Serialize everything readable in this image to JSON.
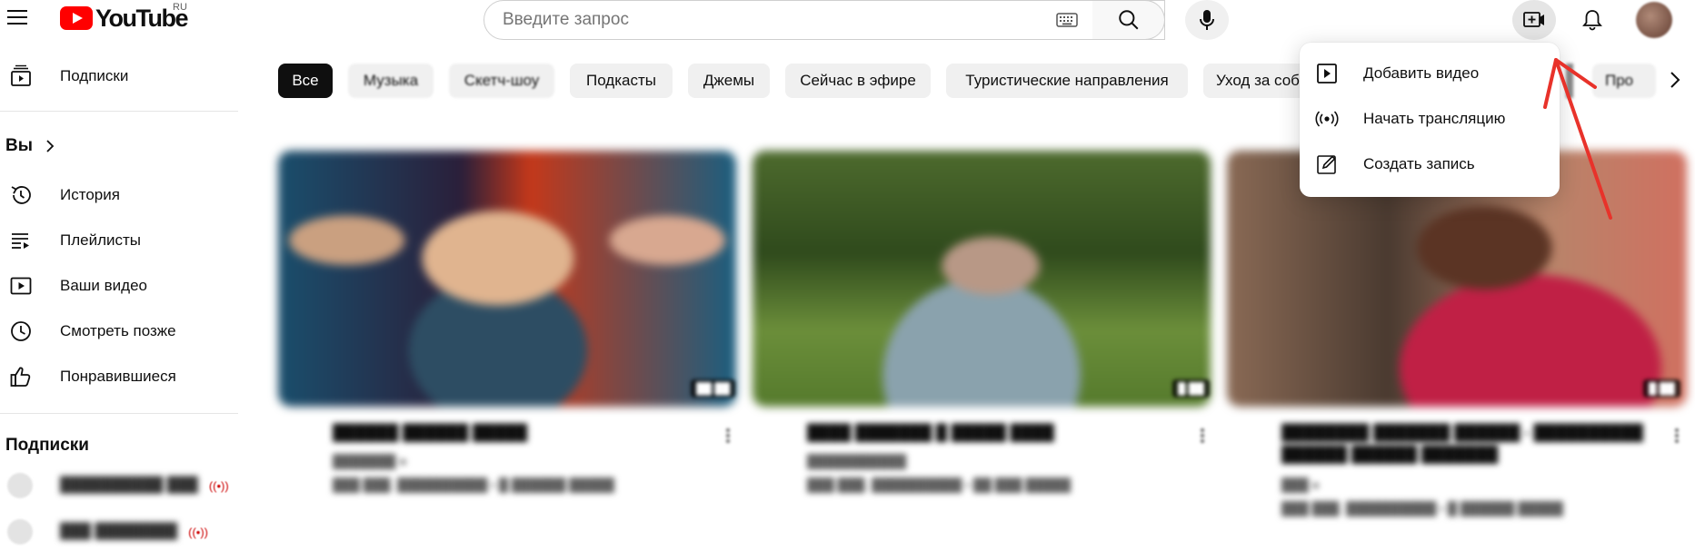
{
  "header": {
    "logo_text": "YouTube",
    "country_code": "RU",
    "search_placeholder": "Введите запрос"
  },
  "sidebar": {
    "top_items": [
      {
        "label": "Подписки",
        "icon": "subscriptions-icon"
      }
    ],
    "you_section": {
      "title": "Вы"
    },
    "you_items": [
      {
        "label": "История",
        "icon": "history-icon"
      },
      {
        "label": "Плейлисты",
        "icon": "playlists-icon"
      },
      {
        "label": "Ваши видео",
        "icon": "your-videos-icon"
      },
      {
        "label": "Смотреть позже",
        "icon": "watch-later-icon"
      },
      {
        "label": "Понравившиеся",
        "icon": "liked-icon"
      }
    ],
    "subscriptions_section": {
      "title": "Подписки"
    }
  },
  "chips": [
    {
      "label": "Все",
      "active": true
    },
    {
      "label": "Музыка"
    },
    {
      "label": "Скетч-шоу"
    },
    {
      "label": "Подкасты"
    },
    {
      "label": "Джемы"
    },
    {
      "label": "Сейчас в эфире"
    },
    {
      "label": "Туристические направления"
    },
    {
      "label": "Уход за соб"
    },
    {
      "label": "Про"
    }
  ],
  "create_menu": {
    "items": [
      {
        "label": "Добавить видео",
        "icon": "upload-video-icon"
      },
      {
        "label": "Начать трансляцию",
        "icon": "go-live-icon"
      },
      {
        "label": "Создать запись",
        "icon": "create-post-icon"
      }
    ]
  },
  "colors": {
    "brand_red": "#ff0000",
    "annotation_arrow": "#e8322a",
    "chip_active_bg": "#0f0f0f",
    "chip_bg": "#f0f0f0"
  }
}
